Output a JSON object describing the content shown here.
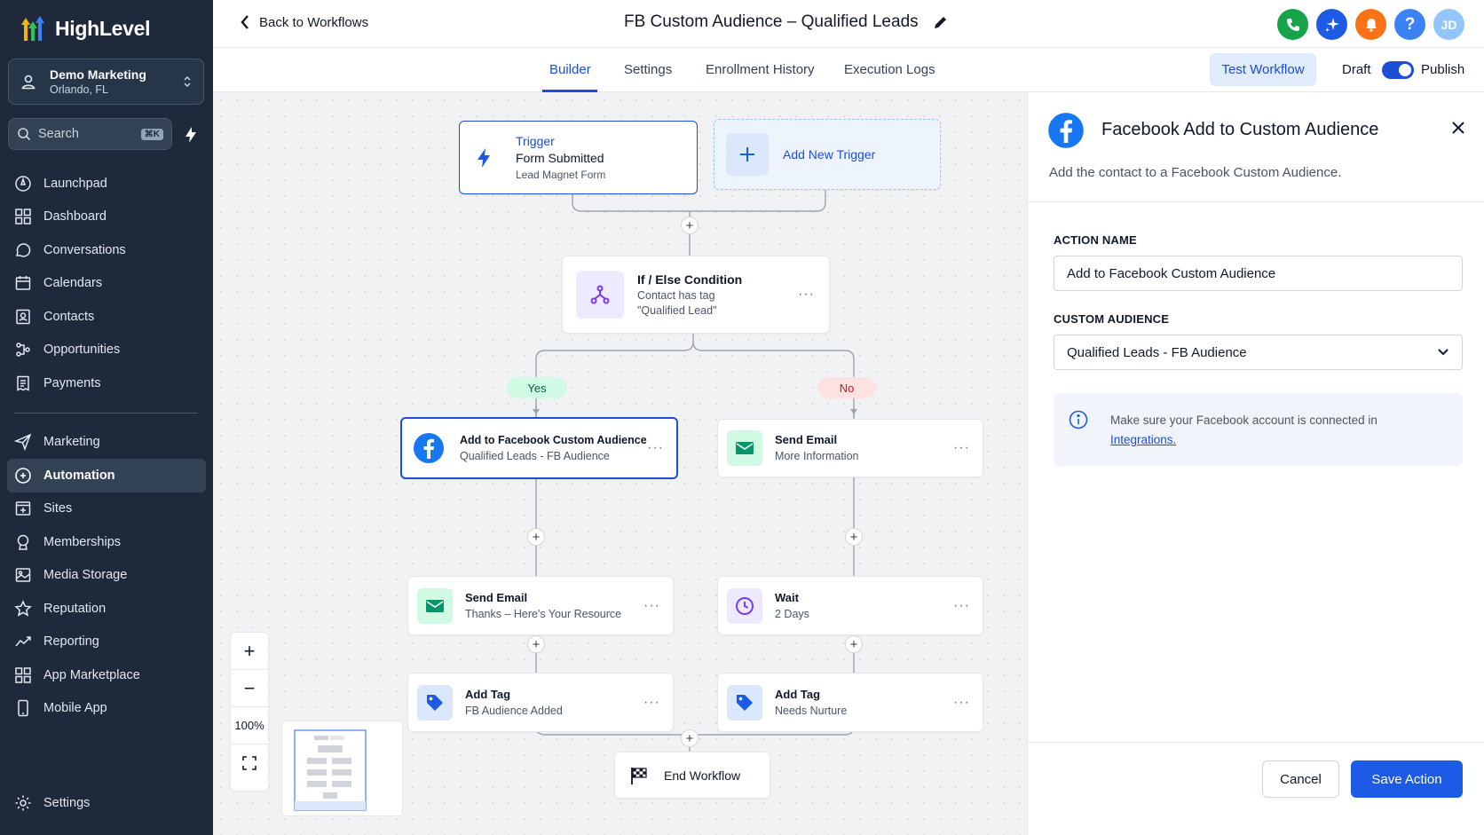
{
  "brand": {
    "name": "HighLevel"
  },
  "account": {
    "name": "Demo Marketing",
    "location": "Orlando, FL"
  },
  "search": {
    "label": "Search",
    "shortcut": "⌘K"
  },
  "nav": {
    "items": [
      {
        "label": "Launchpad",
        "icon": "launchpad-icon"
      },
      {
        "label": "Dashboard",
        "icon": "dashboard-icon"
      },
      {
        "label": "Conversations",
        "icon": "chat-icon"
      },
      {
        "label": "Calendars",
        "icon": "calendar-icon"
      },
      {
        "label": "Contacts",
        "icon": "contacts-icon"
      },
      {
        "label": "Opportunities",
        "icon": "opportunities-icon"
      },
      {
        "label": "Payments",
        "icon": "payments-icon"
      }
    ],
    "items2": [
      {
        "label": "Marketing",
        "icon": "send-icon"
      },
      {
        "label": "Automation",
        "icon": "automation-icon",
        "active": true
      },
      {
        "label": "Sites",
        "icon": "sites-icon"
      },
      {
        "label": "Memberships",
        "icon": "memberships-icon"
      },
      {
        "label": "Media Storage",
        "icon": "media-icon"
      },
      {
        "label": "Reputation",
        "icon": "star-icon"
      },
      {
        "label": "Reporting",
        "icon": "reporting-icon"
      },
      {
        "label": "App Marketplace",
        "icon": "apps-icon"
      },
      {
        "label": "Mobile App",
        "icon": "mobile-icon"
      }
    ],
    "settings": "Settings"
  },
  "header": {
    "back": "Back to Workflows",
    "title": "FB Custom Audience – Qualified Leads",
    "avatar": "JD"
  },
  "tabs": {
    "builder": "Builder",
    "settings": "Settings",
    "enrollment": "Enrollment History",
    "logs": "Execution Logs",
    "test": "Test Workflow",
    "draft": "Draft",
    "publish": "Publish",
    "publish_on": true
  },
  "workflow": {
    "trigger": {
      "label": "Trigger",
      "title": "Form Submitted",
      "sub": "Lead Magnet Form"
    },
    "add_trigger": "Add New Trigger",
    "condition": {
      "title": "If / Else Condition",
      "sub1": "Contact has tag",
      "sub2": "\"Qualified Lead\""
    },
    "yes": "Yes",
    "no": "No",
    "yes_branch": [
      {
        "title": "Add to Facebook Custom Audience",
        "sub": "Qualified Leads - FB Audience"
      },
      {
        "title": "Send Email",
        "sub": "Thanks – Here's Your Resource"
      },
      {
        "title": "Add Tag",
        "sub": "FB Audience Added"
      }
    ],
    "no_branch": [
      {
        "title": "Send Email",
        "sub": "More Information"
      },
      {
        "title": "Wait",
        "sub": "2 Days"
      },
      {
        "title": "Add Tag",
        "sub": "Needs Nurture"
      }
    ],
    "end": "End Workflow",
    "zoom": "100%"
  },
  "panel": {
    "title": "Facebook Add to Custom Audience",
    "description": "Add the contact to a Facebook Custom Audience.",
    "action_name_label": "ACTION NAME",
    "action_name_value": "Add to Facebook Custom Audience",
    "audience_label": "CUSTOM AUDIENCE",
    "audience_value": "Qualified Leads - FB Audience",
    "info_text": "Make sure your Facebook account is connected in",
    "info_link": "Integrations.",
    "cancel": "Cancel",
    "save": "Save Action"
  },
  "colors": {
    "sidebar": "#1e293b",
    "accent": "#1d4ed8",
    "facebook": "#1877f2",
    "email": "#059669",
    "yes": "#065f46",
    "no": "#b91c1c"
  }
}
